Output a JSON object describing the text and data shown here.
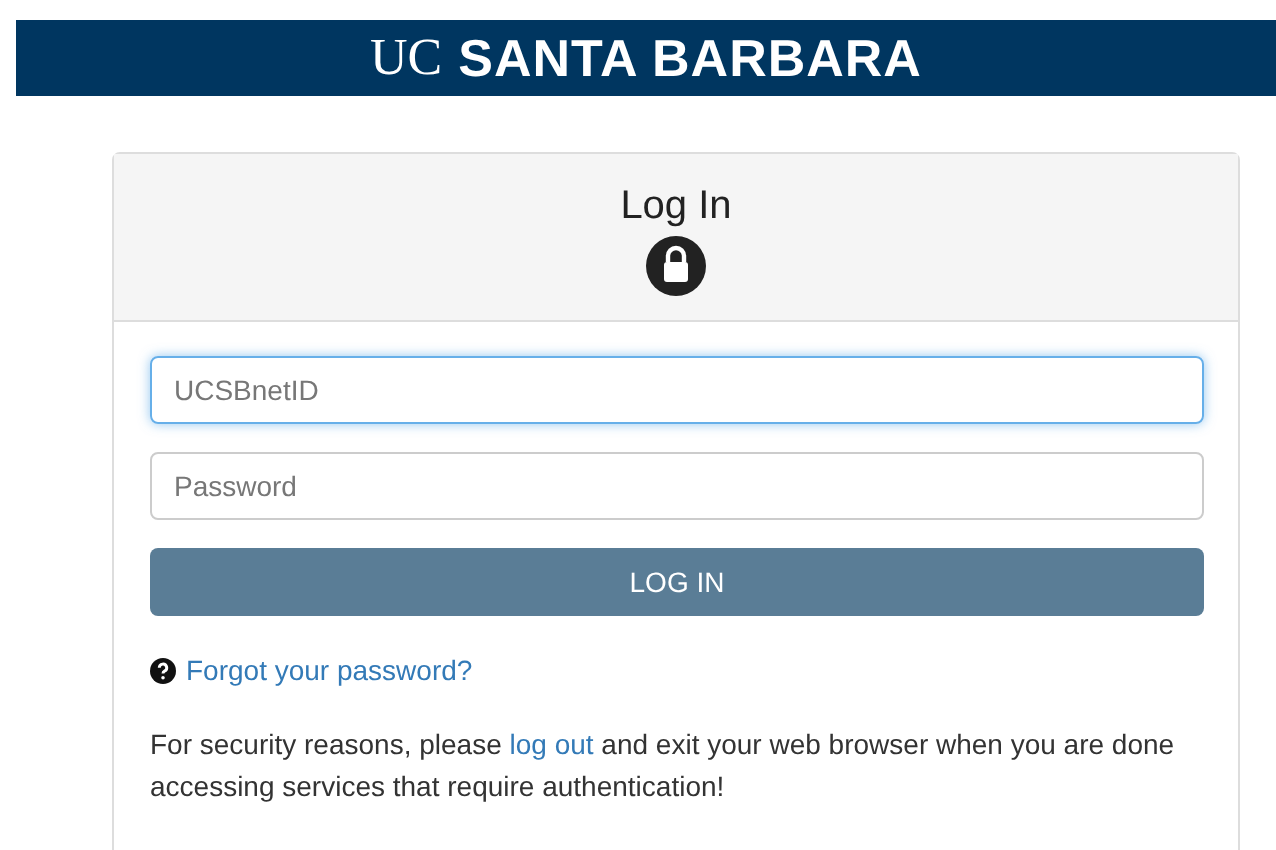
{
  "banner": {
    "logo_light": "UC",
    "logo_bold": "SANTA BARBARA"
  },
  "card": {
    "title": "Log In",
    "fields": [
      {
        "placeholder": "UCSBnetID",
        "focused": true
      },
      {
        "placeholder": "Password",
        "focused": false
      }
    ],
    "submit": "LOG IN",
    "forgot_link": "Forgot your password?",
    "notice": {
      "before": "For security reasons, please ",
      "link": "log out",
      "after": " and exit your web browser when you are done accessing services that require authentication!"
    }
  }
}
